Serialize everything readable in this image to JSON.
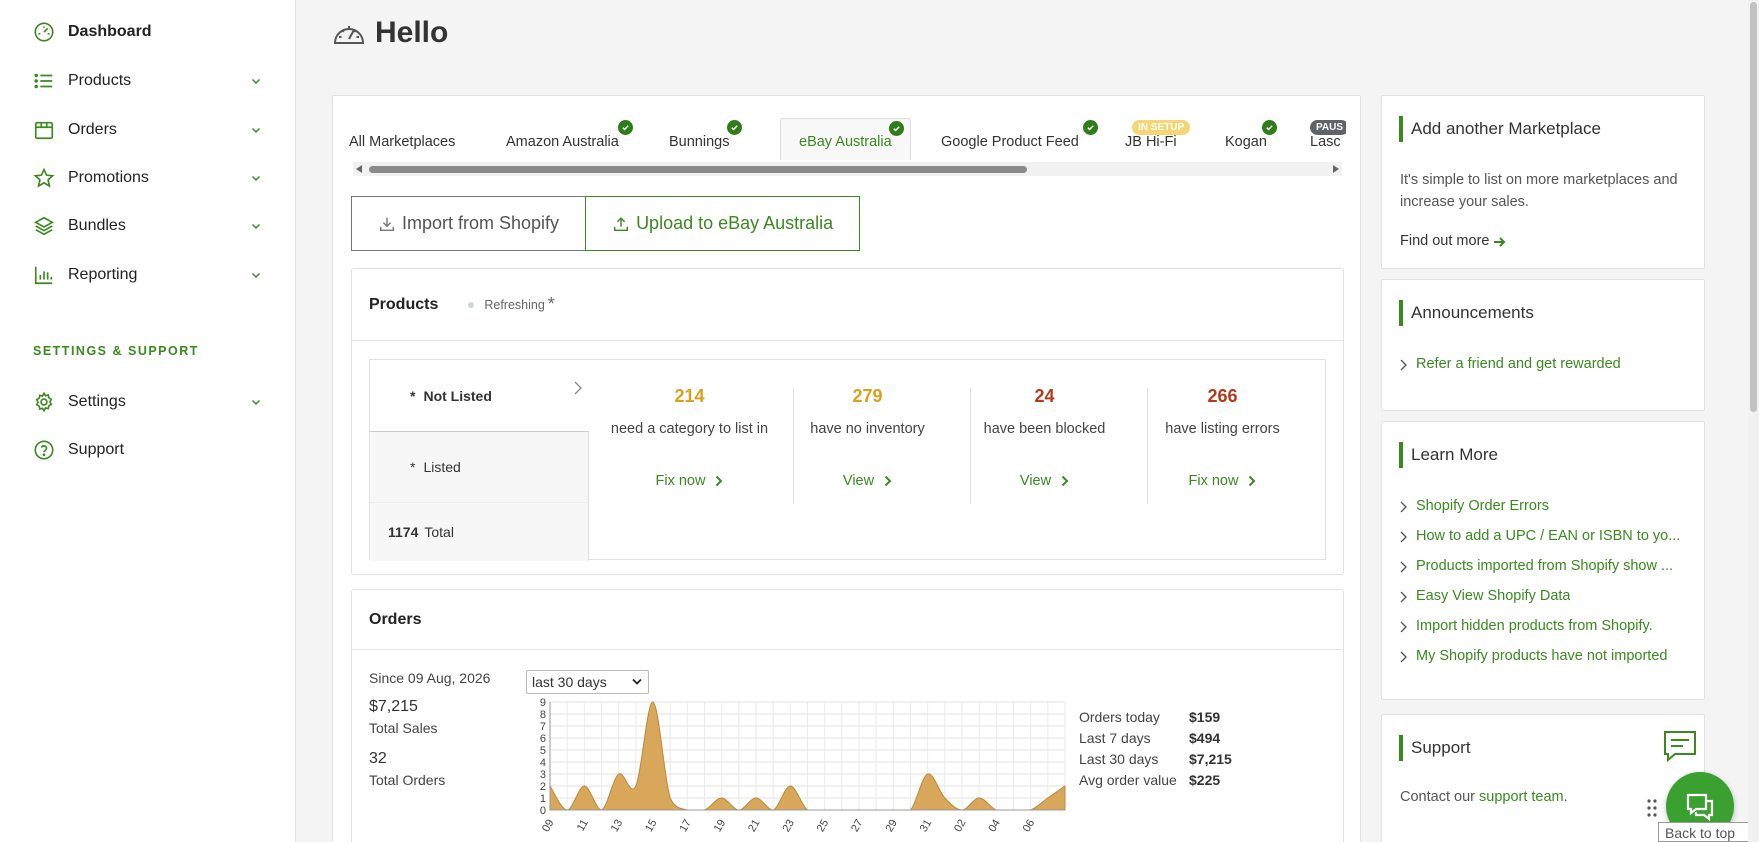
{
  "nav": {
    "items": [
      {
        "label": "Dashboard",
        "icon": "dashboard-gauge-icon"
      },
      {
        "label": "Products",
        "icon": "list-icon"
      },
      {
        "label": "Orders",
        "icon": "shopping-bag-icon"
      },
      {
        "label": "Promotions",
        "icon": "star-icon"
      },
      {
        "label": "Bundles",
        "icon": "layers-icon"
      },
      {
        "label": "Reporting",
        "icon": "bar-chart-icon"
      }
    ],
    "section_title": "SETTINGS & SUPPORT",
    "support_items": [
      {
        "label": "Settings",
        "icon": "gear-icon"
      },
      {
        "label": "Support",
        "icon": "help-circle-icon"
      }
    ]
  },
  "page": {
    "title": "Hello"
  },
  "tabs": [
    {
      "label": "All Marketplaces"
    },
    {
      "label": "Amazon Australia"
    },
    {
      "label": "Bunnings"
    },
    {
      "label": "eBay Australia"
    },
    {
      "label": "Google Product Feed"
    },
    {
      "label": "JB Hi-Fi",
      "badge": "IN SETUP"
    },
    {
      "label": "Kogan"
    },
    {
      "label": "Lasc",
      "badge": "PAUS"
    }
  ],
  "actions": {
    "import_label": "Import from Shopify",
    "upload_label": "Upload to eBay Australia"
  },
  "products": {
    "title": "Products",
    "status": "Refreshing",
    "status_marker": "*",
    "tabs": {
      "not_listed": "Not Listed",
      "listed": "Listed",
      "marker": "*",
      "total_count": "1174",
      "total_label": "Total"
    },
    "stats": [
      {
        "value": "214",
        "desc": "need a category to list in",
        "action": "Fix now",
        "color": "#d9a01b"
      },
      {
        "value": "279",
        "desc": "have no inventory",
        "action": "View",
        "color": "#d9a01b"
      },
      {
        "value": "24",
        "desc": "have been blocked",
        "action": "View",
        "color": "#b23a1a"
      },
      {
        "value": "266",
        "desc": "have listing errors",
        "action": "Fix now",
        "color": "#b23a1a"
      }
    ]
  },
  "orders": {
    "title": "Orders",
    "since": "Since 09 Aug, 2026",
    "total_sales": "$7,215",
    "total_sales_label": "Total Sales",
    "total_orders": "32",
    "total_orders_label": "Total Orders",
    "period": "last 30 days",
    "summary": [
      {
        "label": "Orders today",
        "value": "$159"
      },
      {
        "label": "Last 7 days",
        "value": "$494"
      },
      {
        "label": "Last 30 days",
        "value": "$7,215"
      },
      {
        "label": "Avg order value",
        "value": "$225"
      }
    ]
  },
  "chart_data": {
    "type": "area",
    "x_ticks": [
      "09",
      "11",
      "13",
      "15",
      "17",
      "19",
      "21",
      "23",
      "25",
      "27",
      "29",
      "31",
      "02",
      "04",
      "06"
    ],
    "y_ticks": [
      0,
      1,
      2,
      3,
      4,
      5,
      6,
      7,
      8,
      9
    ],
    "ylim": [
      0,
      9
    ],
    "values": [
      2,
      0,
      2,
      0,
      3,
      2,
      9,
      1,
      0,
      0,
      1,
      0,
      1,
      0,
      2,
      0,
      0,
      0,
      0,
      0,
      0,
      0,
      3,
      1,
      0,
      1,
      0,
      0,
      0,
      1,
      2
    ],
    "grid": true,
    "color": "#d9a75a"
  },
  "right": {
    "marketplace": {
      "title": "Add another Marketplace",
      "body": "It's simple to list on more marketplaces and increase your sales.",
      "link": "Find out more"
    },
    "announcements": {
      "title": "Announcements",
      "links": [
        "Refer a friend and get rewarded"
      ]
    },
    "learn": {
      "title": "Learn More",
      "links": [
        "Shopify Order Errors",
        "How to add a UPC / EAN or ISBN to yo...",
        "Products imported from Shopify show ...",
        "Easy View Shopify Data",
        "Import hidden products from Shopify.",
        "My Shopify products have not imported"
      ]
    },
    "support": {
      "title": "Support",
      "body_prefix": "Contact our ",
      "body_link": "support team",
      "body_suffix": "."
    }
  },
  "back_to_top": "Back to top",
  "colors": {
    "accent": "#3a8a1f",
    "chat": "#3aa02f"
  }
}
